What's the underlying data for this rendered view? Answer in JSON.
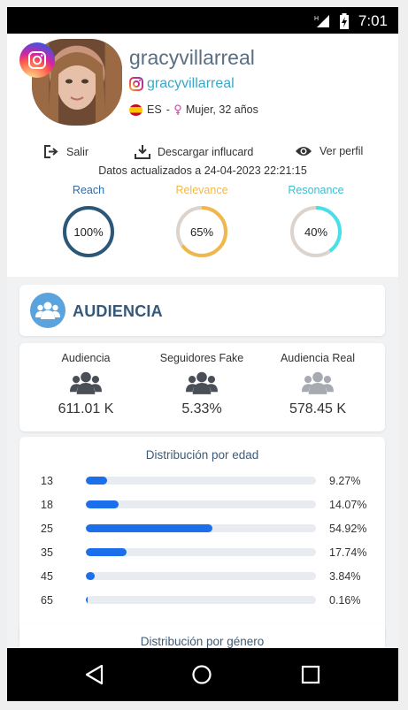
{
  "status": {
    "time": "7:01",
    "network": "H"
  },
  "profile": {
    "name": "gracyvillarreal",
    "handle": "gracyvillarreal",
    "country": "ES",
    "meta": "Mujer, 32 años"
  },
  "actions": {
    "logout": "Salir",
    "download": "Descargar influcard",
    "view": "Ver perfil"
  },
  "updated": "Datos actualizados a 24-04-2023 22:21:15",
  "metrics": [
    {
      "label": "Reach",
      "value": "100%",
      "percent": 100,
      "color": "#2b5879"
    },
    {
      "label": "Relevance",
      "value": "65%",
      "percent": 65,
      "color": "#f0b84a"
    },
    {
      "label": "Resonance",
      "value": "40%",
      "percent": 40,
      "color": "#48e0e8"
    }
  ],
  "audience": {
    "title": "AUDIENCIA",
    "stats": [
      {
        "label": "Audiencia",
        "value": "611.01 K",
        "icon": "users-icon",
        "color": "#4a4f57"
      },
      {
        "label": "Seguidores Fake",
        "value": "5.33%",
        "icon": "users-icon",
        "color": "#4a4f57"
      },
      {
        "label": "Audiencia Real",
        "value": "578.45 K",
        "icon": "users-icon",
        "color": "#a7abb1"
      }
    ]
  },
  "age_distribution": {
    "title": "Distribución por edad",
    "rows": [
      {
        "age": "13",
        "pct": "9.27%",
        "value": 9.27
      },
      {
        "age": "18",
        "pct": "14.07%",
        "value": 14.07
      },
      {
        "age": "25",
        "pct": "54.92%",
        "value": 54.92
      },
      {
        "age": "35",
        "pct": "17.74%",
        "value": 17.74
      },
      {
        "age": "45",
        "pct": "3.84%",
        "value": 3.84
      },
      {
        "age": "65",
        "pct": "0.16%",
        "value": 0.16
      }
    ]
  },
  "gender_distribution": {
    "title": "Distribución por género"
  }
}
